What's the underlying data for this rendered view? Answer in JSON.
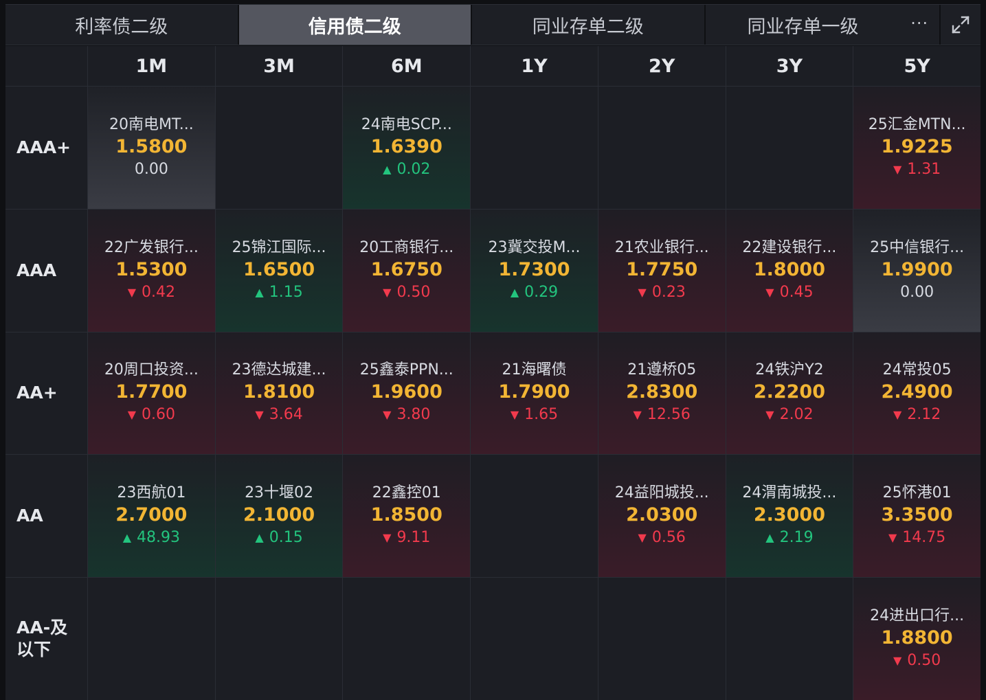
{
  "tabs": [
    {
      "label": "利率债二级",
      "active": false
    },
    {
      "label": "信用债二级",
      "active": true
    },
    {
      "label": "同业存单二级",
      "active": false
    },
    {
      "label": "同业存单一级",
      "active": false
    }
  ],
  "tab_more_label": "···",
  "icons": {
    "more": "more-icon",
    "expand": "expand-icon"
  },
  "colors": {
    "yield": "#f2b534",
    "down": "#f23a4d",
    "up": "#23c47e"
  },
  "columns": [
    "1M",
    "3M",
    "6M",
    "1Y",
    "2Y",
    "3Y",
    "5Y"
  ],
  "rows": [
    {
      "rating": "AAA+",
      "cells": [
        {
          "name": "20南电MT...",
          "yield": "1.5800",
          "change": "0.00",
          "dir": "flat"
        },
        null,
        {
          "name": "24南电SCP...",
          "yield": "1.6390",
          "change": "0.02",
          "dir": "up"
        },
        null,
        null,
        null,
        {
          "name": "25汇金MTN...",
          "yield": "1.9225",
          "change": "1.31",
          "dir": "down"
        }
      ]
    },
    {
      "rating": "AAA",
      "cells": [
        {
          "name": "22广发银行...",
          "yield": "1.5300",
          "change": "0.42",
          "dir": "down"
        },
        {
          "name": "25锦江国际...",
          "yield": "1.6500",
          "change": "1.15",
          "dir": "up"
        },
        {
          "name": "20工商银行...",
          "yield": "1.6750",
          "change": "0.50",
          "dir": "down"
        },
        {
          "name": "23冀交投M...",
          "yield": "1.7300",
          "change": "0.29",
          "dir": "up"
        },
        {
          "name": "21农业银行...",
          "yield": "1.7750",
          "change": "0.23",
          "dir": "down"
        },
        {
          "name": "22建设银行...",
          "yield": "1.8000",
          "change": "0.45",
          "dir": "down"
        },
        {
          "name": "25中信银行...",
          "yield": "1.9900",
          "change": "0.00",
          "dir": "flat"
        }
      ]
    },
    {
      "rating": "AA+",
      "cells": [
        {
          "name": "20周口投资...",
          "yield": "1.7700",
          "change": "0.60",
          "dir": "down"
        },
        {
          "name": "23德达城建...",
          "yield": "1.8100",
          "change": "3.64",
          "dir": "down"
        },
        {
          "name": "25鑫泰PPN...",
          "yield": "1.9600",
          "change": "3.80",
          "dir": "down"
        },
        {
          "name": "21海曙债",
          "yield": "1.7900",
          "change": "1.65",
          "dir": "down"
        },
        {
          "name": "21遵桥05",
          "yield": "2.8300",
          "change": "12.56",
          "dir": "down"
        },
        {
          "name": "24铁沪Y2",
          "yield": "2.2200",
          "change": "2.02",
          "dir": "down"
        },
        {
          "name": "24常投05",
          "yield": "2.4900",
          "change": "2.12",
          "dir": "down"
        }
      ]
    },
    {
      "rating": "AA",
      "cells": [
        {
          "name": "23西航01",
          "yield": "2.7000",
          "change": "48.93",
          "dir": "up"
        },
        {
          "name": "23十堰02",
          "yield": "2.1000",
          "change": "0.15",
          "dir": "up"
        },
        {
          "name": "22鑫控01",
          "yield": "1.8500",
          "change": "9.11",
          "dir": "down"
        },
        null,
        {
          "name": "24益阳城投...",
          "yield": "2.0300",
          "change": "0.56",
          "dir": "down"
        },
        {
          "name": "24渭南城投...",
          "yield": "2.3000",
          "change": "2.19",
          "dir": "up"
        },
        {
          "name": "25怀港01",
          "yield": "3.3500",
          "change": "14.75",
          "dir": "down"
        }
      ]
    },
    {
      "rating_lines": [
        "AA-及",
        "以下"
      ],
      "cells": [
        null,
        null,
        null,
        null,
        null,
        null,
        {
          "name": "24进出口行...",
          "yield": "1.8800",
          "change": "0.50",
          "dir": "down"
        }
      ]
    }
  ]
}
